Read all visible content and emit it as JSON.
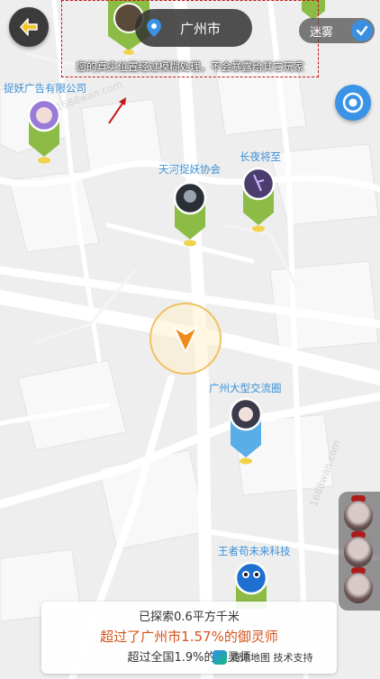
{
  "header": {
    "back_icon": "arrow-left-icon",
    "city": "广州市",
    "privacy_note": "您的真实位置经过模糊处理，不会暴露给其它玩家",
    "fog_label": "迷雾",
    "fog_checked": true
  },
  "map": {
    "places": [
      {
        "label": "捉妖广告有限公司"
      },
      {
        "label": "天河捉妖协会"
      },
      {
        "label": "长夜将至"
      },
      {
        "label": "广州大型交流圈"
      },
      {
        "label": "王者苟未来科技"
      }
    ],
    "watermark": "1688wan.com"
  },
  "stats": {
    "explored": "已探索0.6平方千米",
    "city_rank": "超过了广州市1.57%的御灵师",
    "national_rank": "超过全国1.9%的御灵师"
  },
  "footer": {
    "brand": "腾讯地图 技术支持"
  },
  "colors": {
    "accent_blue": "#3a93e6",
    "highlight_orange": "#d6541c",
    "pin_green": "#8cbc45",
    "pin_blue": "#5aaee8",
    "annotation_red": "#c41616"
  }
}
